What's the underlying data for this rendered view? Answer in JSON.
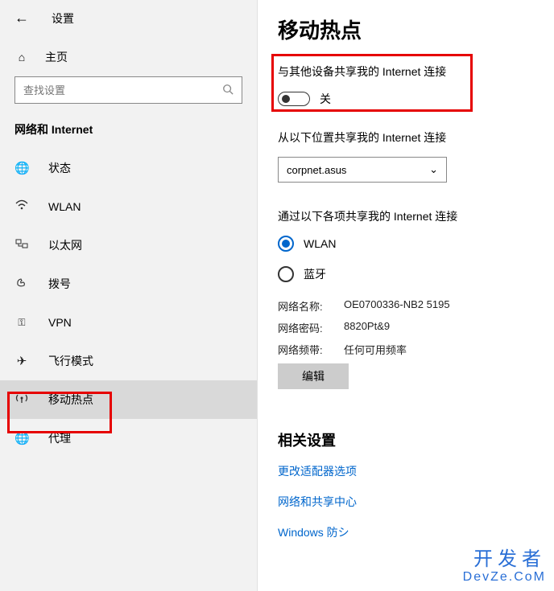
{
  "header": {
    "title": "设置"
  },
  "sidebar": {
    "home": "主页",
    "search_placeholder": "查找设置",
    "section": "网络和 Internet",
    "items": [
      {
        "label": "状态"
      },
      {
        "label": "WLAN"
      },
      {
        "label": "以太网"
      },
      {
        "label": "拨号"
      },
      {
        "label": "VPN"
      },
      {
        "label": "飞行模式"
      },
      {
        "label": "移动热点"
      },
      {
        "label": "代理"
      }
    ]
  },
  "main": {
    "title": "移动热点",
    "share_label": "与其他设备共享我的 Internet 连接",
    "toggle_state": "关",
    "share_from_label": "从以下位置共享我的 Internet 连接",
    "share_from_value": "corpnet.asus",
    "share_via_label": "通过以下各项共享我的 Internet 连接",
    "radio_wlan": "WLAN",
    "radio_bt": "蓝牙",
    "info": {
      "name_k": "网络名称:",
      "name_v": "OE0700336-NB2 5195",
      "pass_k": "网络密码:",
      "pass_v": "8820Pt&9",
      "band_k": "网络频带:",
      "band_v": "任何可用频率"
    },
    "edit": "编辑",
    "related_title": "相关设置",
    "links": [
      "更改适配器选项",
      "网络和共享中心",
      "Windows 防シ"
    ]
  },
  "watermark": {
    "cn": "开发者",
    "en": "DevZe.CoM"
  }
}
